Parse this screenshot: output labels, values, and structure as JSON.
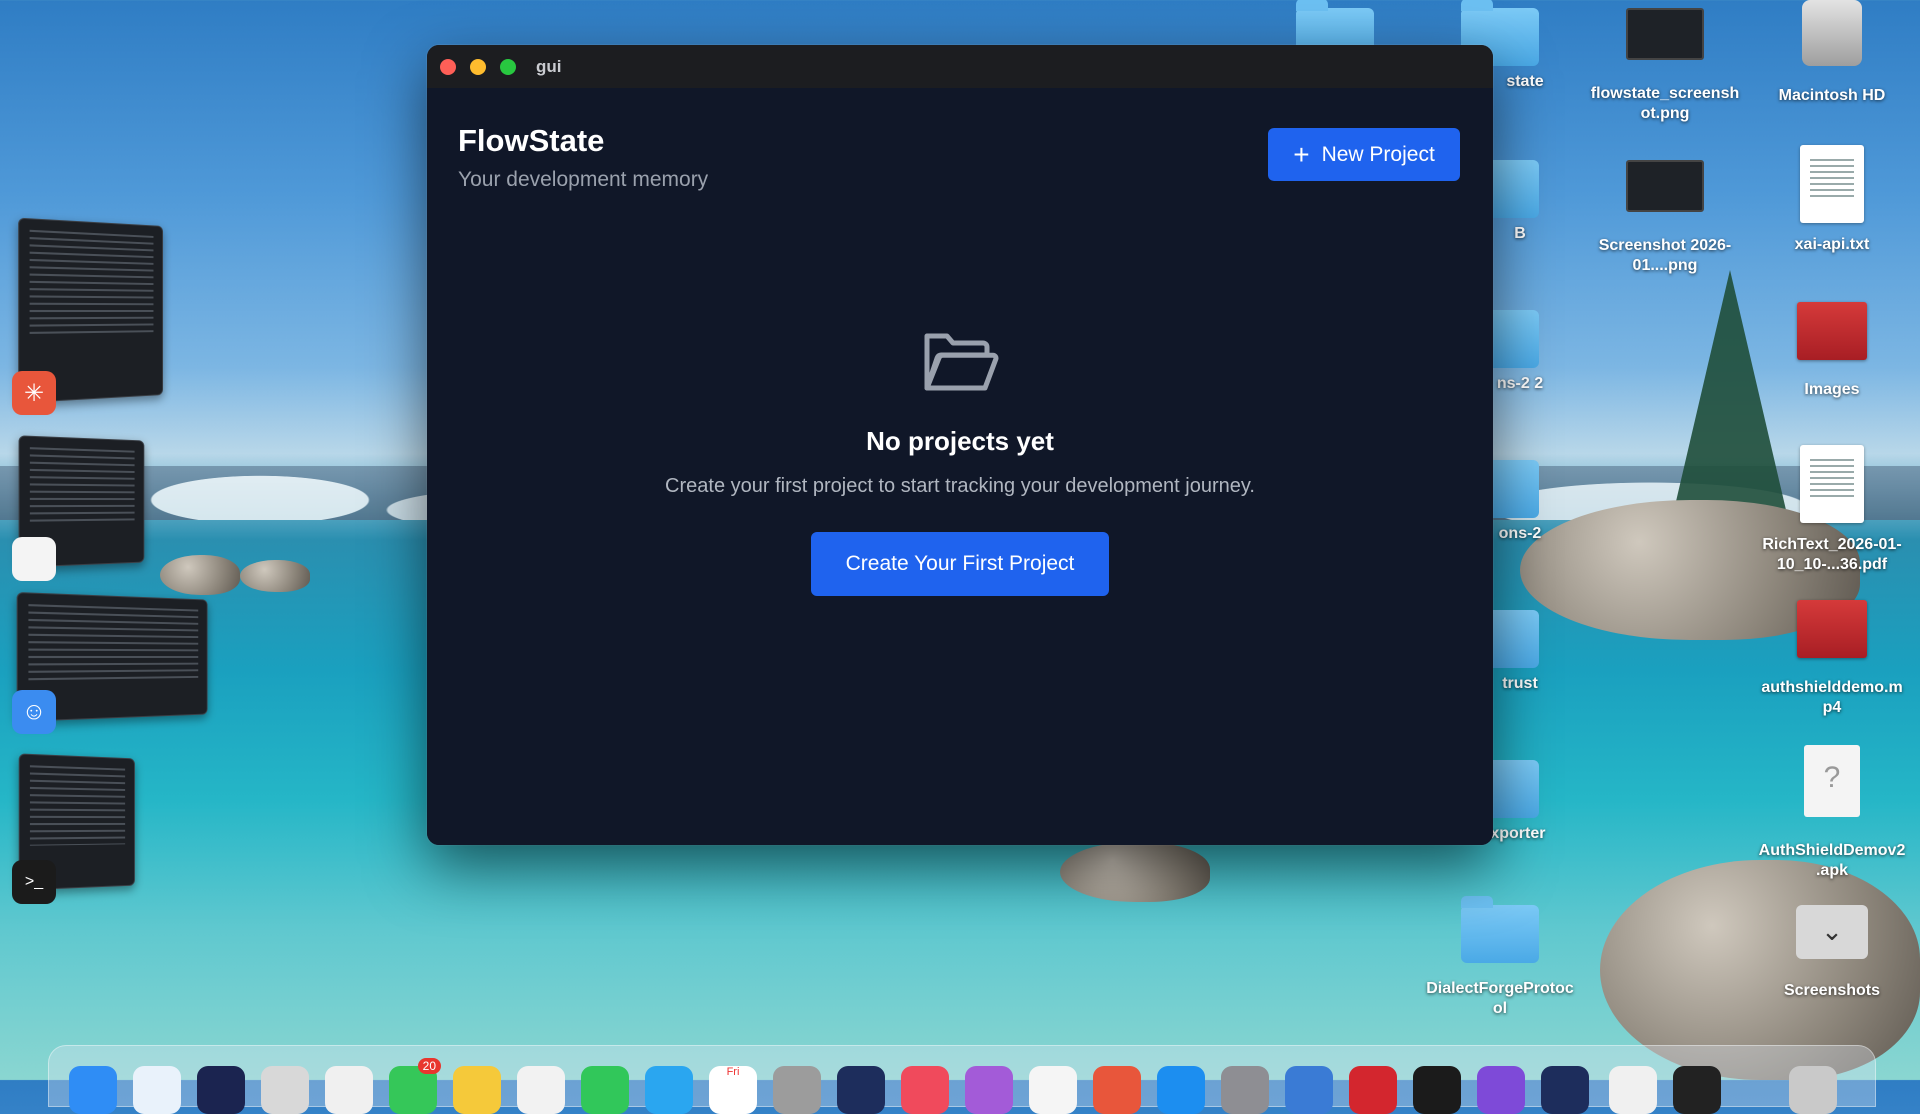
{
  "window": {
    "title": "gui",
    "traffic_lights": {
      "close": "#fe5f57",
      "minimize": "#febc2e",
      "zoom": "#28c840"
    }
  },
  "app": {
    "title": "FlowState",
    "subtitle": "Your development memory",
    "new_project_label": "New Project",
    "accent": "#1f63ee",
    "empty_state": {
      "title": "No projects yet",
      "description": "Create your first project to start tracking your development journey.",
      "cta_label": "Create Your First Project",
      "icon": "folder-open-icon"
    }
  },
  "desktop": {
    "items": [
      {
        "label": "state",
        "kind": "folder"
      },
      {
        "label": "flowstate_screenshot.png",
        "kind": "image"
      },
      {
        "label": "Macintosh HD",
        "kind": "disk"
      },
      {
        "label": "B",
        "kind": "folder"
      },
      {
        "label": "Screenshot 2026-01....png",
        "kind": "image"
      },
      {
        "label": "xai-api.txt",
        "kind": "text"
      },
      {
        "label": "ns-2 2",
        "kind": "folder"
      },
      {
        "label": "Images",
        "kind": "image-stack"
      },
      {
        "label": "ons-2",
        "kind": "folder"
      },
      {
        "label": "RichText_2026-01-10_10-...36.pdf",
        "kind": "pdf"
      },
      {
        "label": "trust",
        "kind": "folder"
      },
      {
        "label": "authshielddemo.mp4",
        "kind": "video"
      },
      {
        "label": "rcExporter",
        "kind": "folder"
      },
      {
        "label": "AuthShieldDemov2.apk",
        "kind": "apk"
      },
      {
        "label": "DialectForgeProtocol",
        "kind": "folder"
      },
      {
        "label": "Screenshots",
        "kind": "stack"
      }
    ]
  },
  "dock": {
    "messages_badge": "20",
    "calendar_day": "Fri"
  }
}
